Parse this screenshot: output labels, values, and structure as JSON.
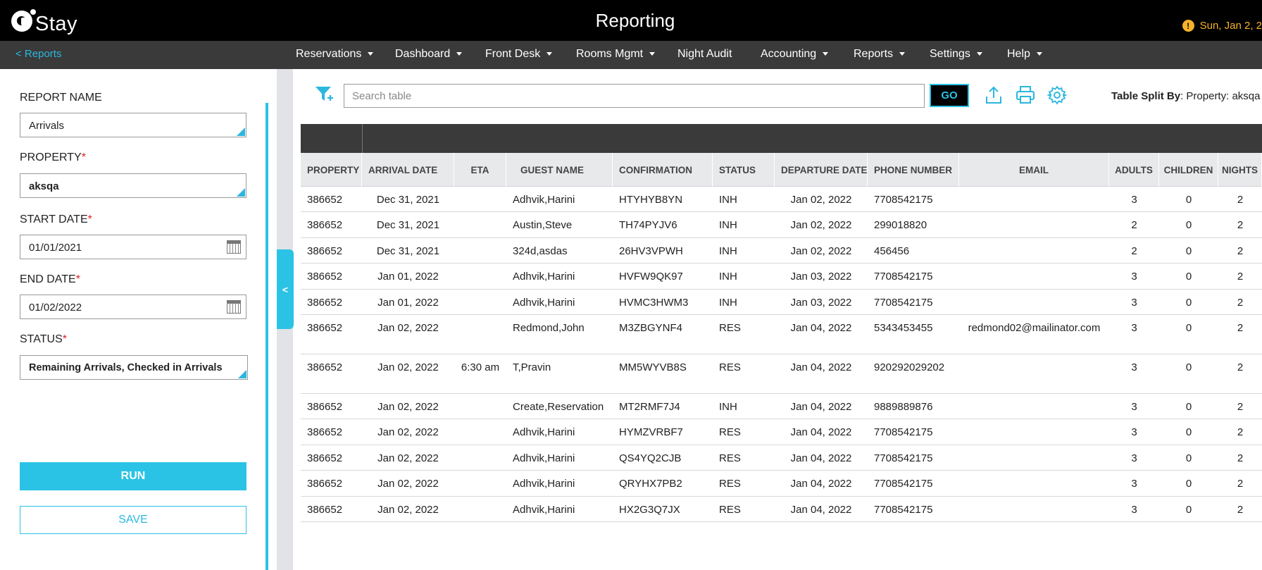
{
  "header": {
    "logo_text": "Stay",
    "title": "Reporting",
    "date_text": "Sun, Jan 2, 2"
  },
  "nav": {
    "back_label": "< Reports",
    "items": [
      {
        "label": "Reservations",
        "dropdown": true
      },
      {
        "label": "Dashboard",
        "dropdown": true
      },
      {
        "label": "Front Desk",
        "dropdown": true
      },
      {
        "label": "Rooms Mgmt",
        "dropdown": true
      },
      {
        "label": "Night Audit",
        "dropdown": false
      },
      {
        "label": "Accounting",
        "dropdown": true
      },
      {
        "label": "Reports",
        "dropdown": true
      },
      {
        "label": "Settings",
        "dropdown": true
      },
      {
        "label": "Help",
        "dropdown": true
      }
    ]
  },
  "sidebar": {
    "report_name": {
      "label": "REPORT NAME",
      "value": "Arrivals"
    },
    "property": {
      "label": "PROPERTY",
      "required_mark": "*",
      "value": "aksqa"
    },
    "start_date": {
      "label": "START DATE",
      "required_mark": "*",
      "value": "01/01/2021"
    },
    "end_date": {
      "label": "END DATE",
      "required_mark": "*",
      "value": "01/02/2022"
    },
    "status": {
      "label": "STATUS",
      "required_mark": "*",
      "value": "Remaining Arrivals, Checked in Arrivals"
    },
    "run_label": "RUN",
    "save_label": "SAVE",
    "collapse_label": "<"
  },
  "toolbar": {
    "search_placeholder": "Search table",
    "go_label": "GO",
    "split_label": "Table Split By",
    "split_value": ": Property: aksqa"
  },
  "table": {
    "columns": [
      "PROPERTY",
      "ARRIVAL DATE",
      "ETA",
      "GUEST NAME",
      "CONFIRMATION",
      "STATUS",
      "DEPARTURE DATE",
      "PHONE NUMBER",
      "EMAIL",
      "ADULTS",
      "CHILDREN",
      "NIGHTS"
    ],
    "rows": [
      [
        "386652",
        "Dec 31, 2021",
        "",
        "Adhvik,Harini",
        "HTYHYB8YN",
        "INH",
        "Jan 02, 2022",
        "7708542175",
        "",
        "3",
        "0",
        "2"
      ],
      [
        "386652",
        "Dec 31, 2021",
        "",
        "Austin,Steve",
        "TH74PYJV6",
        "INH",
        "Jan 02, 2022",
        "299018820",
        "",
        "2",
        "0",
        "2"
      ],
      [
        "386652",
        "Dec 31, 2021",
        "",
        "324d,asdas",
        "26HV3VPWH",
        "INH",
        "Jan 02, 2022",
        "456456",
        "",
        "2",
        "0",
        "2"
      ],
      [
        "386652",
        "Jan 01, 2022",
        "",
        "Adhvik,Harini",
        "HVFW9QK97",
        "INH",
        "Jan 03, 2022",
        "7708542175",
        "",
        "3",
        "0",
        "2"
      ],
      [
        "386652",
        "Jan 01, 2022",
        "",
        "Adhvik,Harini",
        "HVMC3HWM3",
        "INH",
        "Jan 03, 2022",
        "7708542175",
        "",
        "3",
        "0",
        "2"
      ],
      [
        "386652",
        "Jan 02, 2022",
        "",
        "Redmond,John",
        "M3ZBGYNF4",
        "RES",
        "Jan 04, 2022",
        "5343453455",
        "redmond02@mailinator.com",
        "3",
        "0",
        "2"
      ],
      [
        "386652",
        "Jan 02, 2022",
        "6:30 am",
        "T,Pravin",
        "MM5WYVB8S",
        "RES",
        "Jan 04, 2022",
        "920292029202",
        "",
        "3",
        "0",
        "2"
      ],
      [
        "386652",
        "Jan 02, 2022",
        "",
        "Create,Reservation",
        "MT2RMF7J4",
        "INH",
        "Jan 04, 2022",
        "9889889876",
        "",
        "3",
        "0",
        "2"
      ],
      [
        "386652",
        "Jan 02, 2022",
        "",
        "Adhvik,Harini",
        "HYMZVRBF7",
        "RES",
        "Jan 04, 2022",
        "7708542175",
        "",
        "3",
        "0",
        "2"
      ],
      [
        "386652",
        "Jan 02, 2022",
        "",
        "Adhvik,Harini",
        "QS4YQ2CJB",
        "RES",
        "Jan 04, 2022",
        "7708542175",
        "",
        "3",
        "0",
        "2"
      ],
      [
        "386652",
        "Jan 02, 2022",
        "",
        "Adhvik,Harini",
        "QRYHX7PB2",
        "RES",
        "Jan 04, 2022",
        "7708542175",
        "",
        "3",
        "0",
        "2"
      ],
      [
        "386652",
        "Jan 02, 2022",
        "",
        "Adhvik,Harini",
        "HX2G3Q7JX",
        "RES",
        "Jan 04, 2022",
        "7708542175",
        "",
        "3",
        "0",
        "2"
      ]
    ]
  },
  "colors": {
    "accent": "#2bc3e5",
    "header_bg": "#000000",
    "nav_bg": "#3a3a3a",
    "alert": "#f5b32a"
  }
}
